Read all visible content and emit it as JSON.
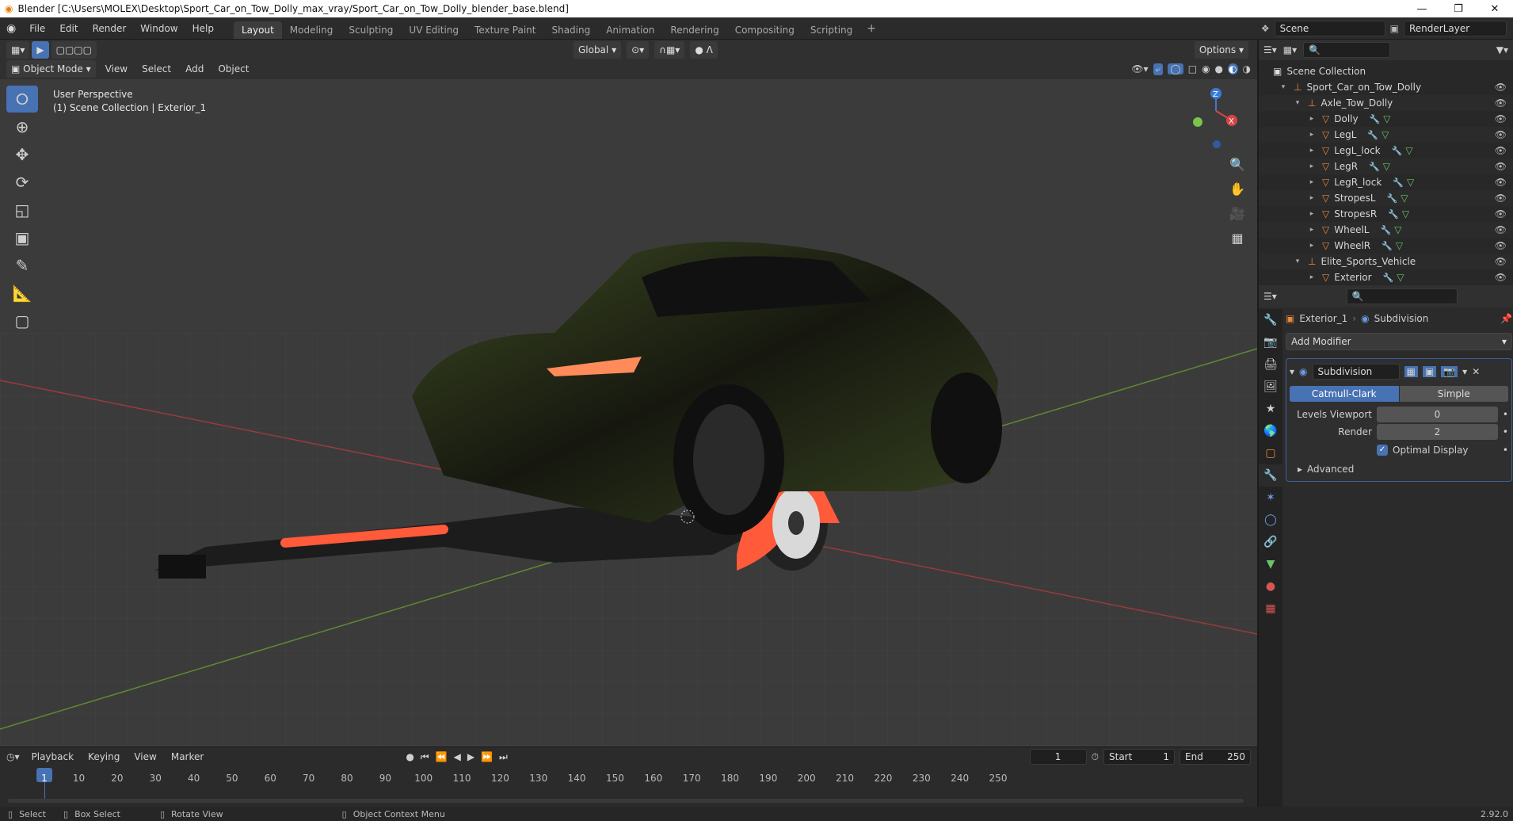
{
  "window": {
    "title": "Blender [C:\\Users\\MOLEX\\Desktop\\Sport_Car_on_Tow_Dolly_max_vray/Sport_Car_on_Tow_Dolly_blender_base.blend]",
    "minimize": "—",
    "restore": "❐",
    "close": "✕"
  },
  "menus": [
    "File",
    "Edit",
    "Render",
    "Window",
    "Help"
  ],
  "workspaces": [
    "Layout",
    "Modeling",
    "Sculpting",
    "UV Editing",
    "Texture Paint",
    "Shading",
    "Animation",
    "Rendering",
    "Compositing",
    "Scripting"
  ],
  "workspace_active": "Layout",
  "add_workspace": "+",
  "scene": {
    "name": "Scene",
    "layer": "RenderLayer"
  },
  "viewport": {
    "orientation": "Global",
    "options": "Options",
    "mode": "Object Mode",
    "menus": [
      "View",
      "Select",
      "Add",
      "Object"
    ],
    "overlay_title": "User Perspective",
    "overlay_sub": "(1) Scene Collection | Exterior_1",
    "gizmo": {
      "z": "Z",
      "x": "X"
    }
  },
  "outliner": {
    "root": "Scene Collection",
    "rows": [
      {
        "label": "Sport_Car_on_Tow_Dolly",
        "indent": 1,
        "open": true,
        "kind": "empty"
      },
      {
        "label": "Axle_Tow_Dolly",
        "indent": 2,
        "open": true,
        "kind": "empty"
      },
      {
        "label": "Dolly",
        "indent": 3,
        "open": false,
        "kind": "mesh"
      },
      {
        "label": "LegL",
        "indent": 3,
        "open": false,
        "kind": "mesh"
      },
      {
        "label": "LegL_lock",
        "indent": 3,
        "open": false,
        "kind": "mesh"
      },
      {
        "label": "LegR",
        "indent": 3,
        "open": false,
        "kind": "mesh"
      },
      {
        "label": "LegR_lock",
        "indent": 3,
        "open": false,
        "kind": "mesh"
      },
      {
        "label": "StropesL",
        "indent": 3,
        "open": false,
        "kind": "mesh"
      },
      {
        "label": "StropesR",
        "indent": 3,
        "open": false,
        "kind": "mesh"
      },
      {
        "label": "WheelL",
        "indent": 3,
        "open": false,
        "kind": "mesh"
      },
      {
        "label": "WheelR",
        "indent": 3,
        "open": false,
        "kind": "mesh"
      },
      {
        "label": "Elite_Sports_Vehicle",
        "indent": 2,
        "open": true,
        "kind": "empty"
      },
      {
        "label": "Exterior",
        "indent": 3,
        "open": false,
        "kind": "mesh"
      }
    ]
  },
  "properties": {
    "breadcrumb_object": "Exterior_1",
    "breadcrumb_modifier": "Subdivision",
    "add_modifier": "Add Modifier",
    "modifier": {
      "name": "Subdivision",
      "mode_a": "Catmull-Clark",
      "mode_b": "Simple",
      "levels_label": "Levels Viewport",
      "levels_value": "0",
      "render_label": "Render",
      "render_value": "2",
      "optimal_label": "Optimal Display",
      "optimal_checked": true,
      "advanced": "Advanced"
    }
  },
  "timeline": {
    "menus": [
      "Playback",
      "Keying",
      "View",
      "Marker"
    ],
    "current_frame": "1",
    "start_label": "Start",
    "start": "1",
    "end_label": "End",
    "end": "250",
    "ticks": [
      "1",
      "10",
      "20",
      "30",
      "40",
      "50",
      "60",
      "70",
      "80",
      "90",
      "100",
      "110",
      "120",
      "130",
      "140",
      "150",
      "160",
      "170",
      "180",
      "190",
      "200",
      "210",
      "220",
      "230",
      "240",
      "250"
    ]
  },
  "statusbar": {
    "select": "Select",
    "box_select": "Box Select",
    "rotate": "Rotate View",
    "context": "Object Context Menu",
    "version": "2.92.0"
  },
  "colors": {
    "accent": "#4772b3",
    "orange": "#e8883a",
    "mesh_green": "#6ac36a"
  }
}
